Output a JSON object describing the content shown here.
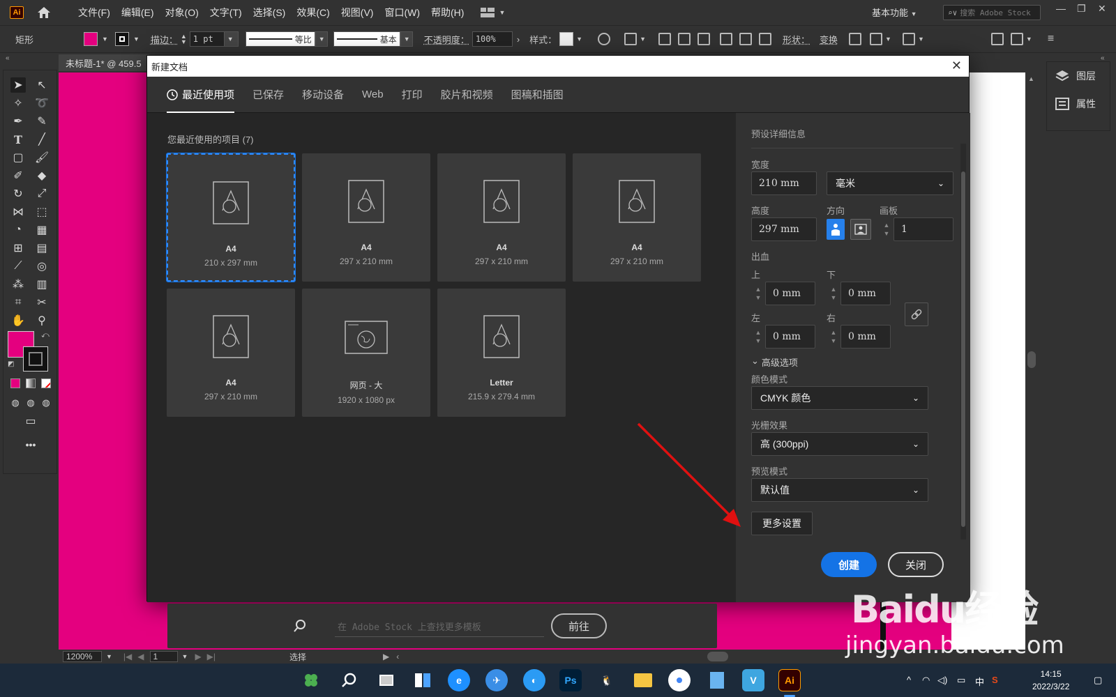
{
  "app": {
    "logo": "Ai",
    "menu": [
      "文件(F)",
      "编辑(E)",
      "对象(O)",
      "文字(T)",
      "选择(S)",
      "效果(C)",
      "视图(V)",
      "窗口(W)",
      "帮助(H)"
    ],
    "workspace": "基本功能",
    "search_placeholder": "搜索 Adobe Stock"
  },
  "controlbar": {
    "tool_name": "矩形",
    "fill_color": "#e4007f",
    "stroke_label": "描边：",
    "stroke_value": "1 pt",
    "profile_1": "等比",
    "profile_2": "基本",
    "opacity_label": "不透明度：",
    "opacity_value": "100%",
    "style_label": "样式：",
    "shape_label": "形状：",
    "transform_label": "变换"
  },
  "document": {
    "tab_title": "未标题-1* @ 459.5",
    "zoom": "1200%",
    "artboard_num": "1",
    "status_tool": "选择"
  },
  "right_panel": {
    "layers": "图层",
    "properties": "属性"
  },
  "dialog": {
    "title": "新建文档",
    "tabs": [
      "最近使用项",
      "已保存",
      "移动设备",
      "Web",
      "打印",
      "胶片和视频",
      "图稿和插图"
    ],
    "recent_title": "您最近使用的项目 (7)",
    "presets": [
      {
        "name": "A4",
        "size": "210 x 297 mm",
        "icon": "document-icon"
      },
      {
        "name": "A4",
        "size": "297 x 210 mm",
        "icon": "document-icon"
      },
      {
        "name": "A4",
        "size": "297 x 210 mm",
        "icon": "document-icon"
      },
      {
        "name": "A4",
        "size": "297 x 210 mm",
        "icon": "document-icon"
      },
      {
        "name": "A4",
        "size": "297 x 210 mm",
        "icon": "document-icon"
      },
      {
        "name": "网页 - 大",
        "size": "1920 x 1080 px",
        "icon": "web-icon"
      },
      {
        "name": "Letter",
        "size": "215.9 x 279.4 mm",
        "icon": "document-icon"
      }
    ],
    "stock_placeholder": "在 Adobe Stock 上查找更多模板",
    "stock_go": "前往",
    "details": {
      "header": "预设详细信息",
      "width_label": "宽度",
      "width_value": "210 mm",
      "unit": "毫米",
      "height_label": "高度",
      "height_value": "297 mm",
      "orientation_label": "方向",
      "artboards_label": "画板",
      "artboards_value": "1",
      "bleed_label": "出血",
      "top_label": "上",
      "top_value": "0 mm",
      "bottom_label": "下",
      "bottom_value": "0 mm",
      "left_label": "左",
      "left_value": "0 mm",
      "right_label": "右",
      "right_value": "0 mm",
      "advanced_label": "高级选项",
      "color_mode_label": "颜色模式",
      "color_mode_value": "CMYK 颜色",
      "raster_label": "光栅效果",
      "raster_value": "高 (300ppi)",
      "preview_label": "预览模式",
      "preview_value": "默认值",
      "more_settings": "更多设置"
    },
    "create": "创建",
    "close": "关闭"
  },
  "taskbar": {
    "time": "14:15",
    "date": "2022/3/22",
    "ime": "中"
  },
  "watermark": {
    "text": "Baidu经验",
    "url": "jingyan.baidu.com"
  }
}
